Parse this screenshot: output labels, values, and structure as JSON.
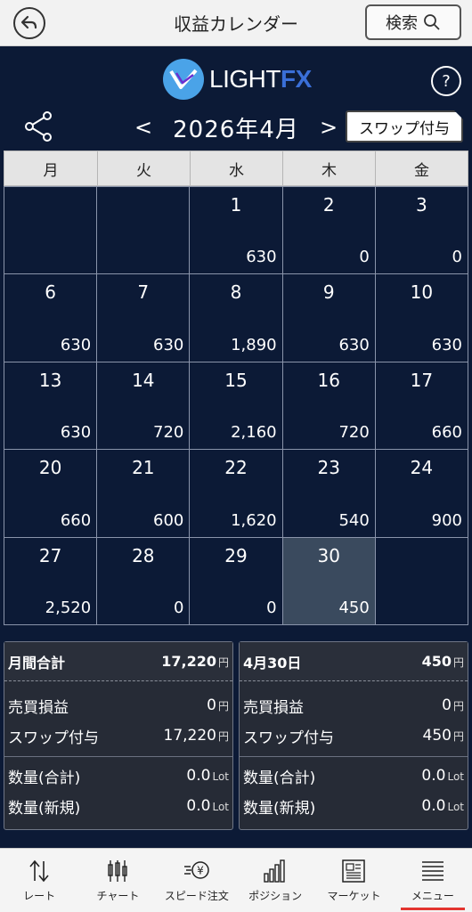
{
  "header": {
    "title": "収益カレンダー",
    "search_label": "検索"
  },
  "logo": {
    "text_light": "LIGHT",
    "text_fx": "FX"
  },
  "help_label": "?",
  "month_nav": {
    "prev": "<",
    "label": "2026年4月",
    "next": ">"
  },
  "swap_button": "スワップ付与",
  "calendar": {
    "weekdays": [
      "月",
      "火",
      "水",
      "木",
      "金"
    ],
    "cells": [
      {
        "day": "",
        "amount": ""
      },
      {
        "day": "",
        "amount": ""
      },
      {
        "day": "1",
        "amount": "630"
      },
      {
        "day": "2",
        "amount": "0"
      },
      {
        "day": "3",
        "amount": "0"
      },
      {
        "day": "6",
        "amount": "630"
      },
      {
        "day": "7",
        "amount": "630"
      },
      {
        "day": "8",
        "amount": "1,890"
      },
      {
        "day": "9",
        "amount": "630"
      },
      {
        "day": "10",
        "amount": "630"
      },
      {
        "day": "13",
        "amount": "630"
      },
      {
        "day": "14",
        "amount": "720"
      },
      {
        "day": "15",
        "amount": "2,160"
      },
      {
        "day": "16",
        "amount": "720"
      },
      {
        "day": "17",
        "amount": "660"
      },
      {
        "day": "20",
        "amount": "660"
      },
      {
        "day": "21",
        "amount": "600"
      },
      {
        "day": "22",
        "amount": "1,620"
      },
      {
        "day": "23",
        "amount": "540"
      },
      {
        "day": "24",
        "amount": "900"
      },
      {
        "day": "27",
        "amount": "2,520"
      },
      {
        "day": "28",
        "amount": "0"
      },
      {
        "day": "29",
        "amount": "0"
      },
      {
        "day": "30",
        "amount": "450",
        "today": true
      },
      {
        "day": "",
        "amount": ""
      }
    ]
  },
  "summary_month": {
    "title": "月間合計",
    "total": "17,220",
    "unit": "円",
    "trade_label": "売買損益",
    "trade_value": "0",
    "swap_label": "スワップ付与",
    "swap_value": "17,220",
    "qty_total_label": "数量(合計)",
    "qty_total_value": "0.0",
    "qty_unit": "Lot",
    "qty_new_label": "数量(新規)",
    "qty_new_value": "0.0"
  },
  "summary_day": {
    "title": "4月30日",
    "total": "450",
    "unit": "円",
    "trade_label": "売買損益",
    "trade_value": "0",
    "swap_label": "スワップ付与",
    "swap_value": "450",
    "qty_total_label": "数量(合計)",
    "qty_total_value": "0.0",
    "qty_unit": "Lot",
    "qty_new_label": "数量(新規)",
    "qty_new_value": "0.0"
  },
  "bottom_nav": {
    "items": [
      {
        "label": "レート",
        "icon": "rate-arrows-icon"
      },
      {
        "label": "チャート",
        "icon": "candlestick-icon"
      },
      {
        "label": "スピード注文",
        "icon": "speed-order-icon"
      },
      {
        "label": "ポジション",
        "icon": "bar-chart-icon"
      },
      {
        "label": "マーケット",
        "icon": "newspaper-icon"
      },
      {
        "label": "メニュー",
        "icon": "menu-icon",
        "active": true
      }
    ],
    "active_color": "#e3342f"
  },
  "colors": {
    "background": "#0c1a36",
    "today_cell": "#3a4a5e",
    "panel": "#262b36"
  }
}
